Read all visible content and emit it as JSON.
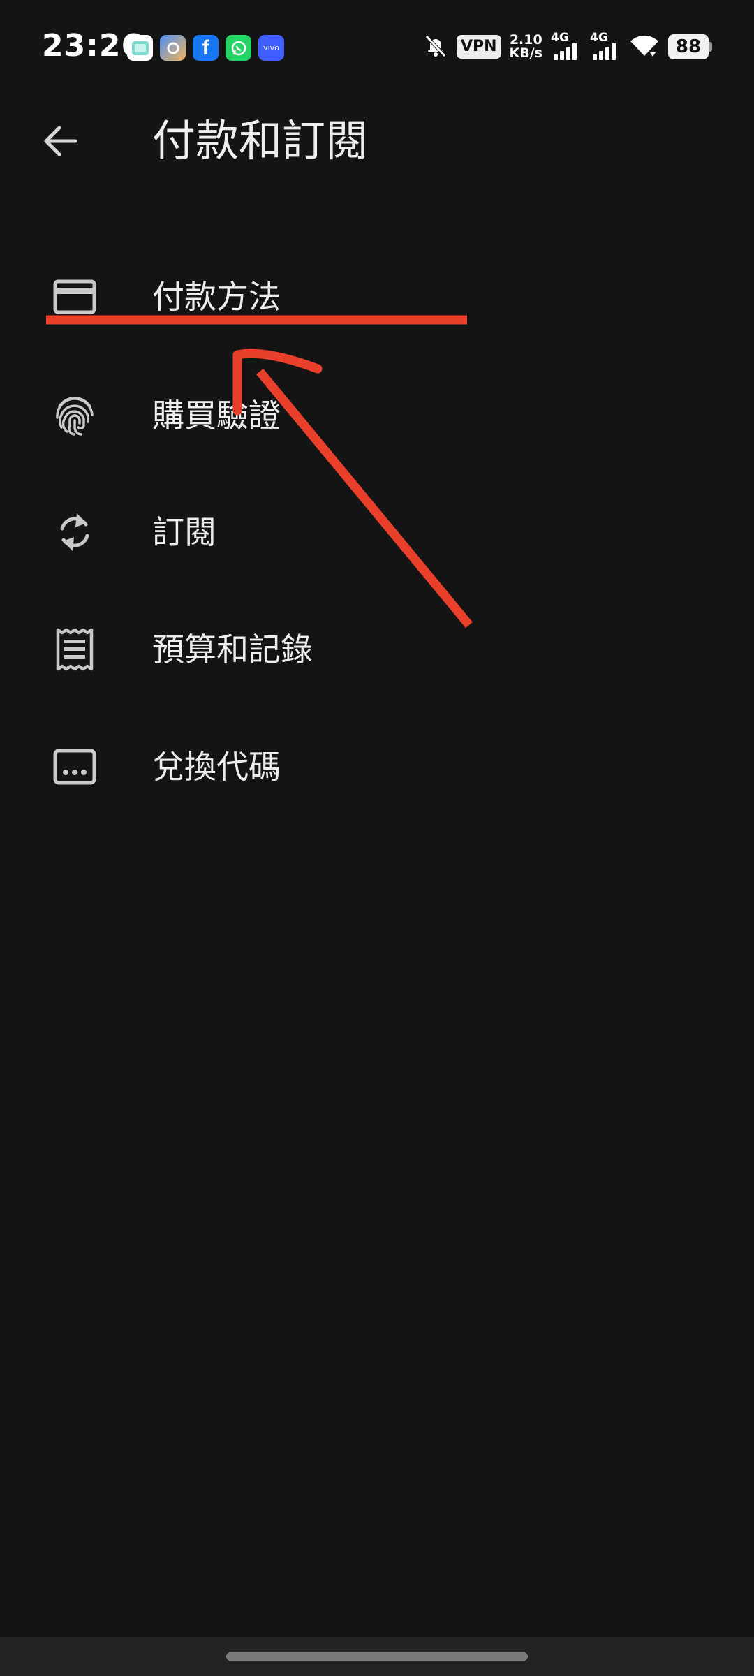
{
  "status_bar": {
    "time": "23:26",
    "notification_icons": [
      "gallery-icon",
      "assistant-icon",
      "facebook-icon",
      "whatsapp-icon",
      "vivo-icon"
    ],
    "vivo_label": "vivo",
    "facebook_label": "f",
    "vpn_label": "VPN",
    "speed_value": "2.10",
    "speed_unit": "KB/s",
    "signal_1_label": "4G",
    "signal_2_label": "4G",
    "battery_level": "88"
  },
  "app_bar": {
    "title": "付款和訂閱"
  },
  "menu": {
    "items": [
      {
        "label": "付款方法",
        "icon": "credit-card-icon"
      },
      {
        "label": "購買驗證",
        "icon": "fingerprint-icon"
      },
      {
        "label": "訂閱",
        "icon": "sync-icon"
      },
      {
        "label": "預算和記錄",
        "icon": "receipt-icon"
      },
      {
        "label": "兌換代碼",
        "icon": "redeem-code-icon"
      }
    ]
  },
  "colors": {
    "background": "#141414",
    "text": "#ededed",
    "icon": "#c9c9c9",
    "annotation": "#e8402a"
  }
}
